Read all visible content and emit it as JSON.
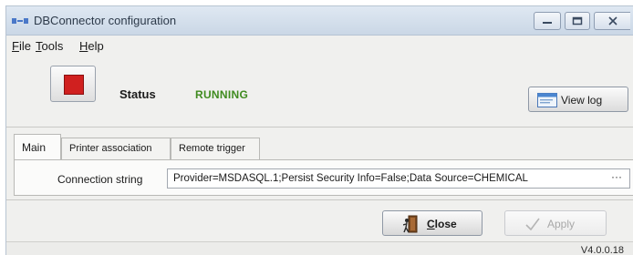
{
  "window": {
    "title": "DBConnector configuration",
    "controls": [
      "minimize-icon",
      "maximize-icon",
      "close-icon"
    ]
  },
  "menu": {
    "items": [
      {
        "mnemonic": "F",
        "rest": "ile"
      },
      {
        "mnemonic": "T",
        "rest": "ools"
      },
      {
        "mnemonic": "H",
        "rest": "elp"
      }
    ]
  },
  "status": {
    "label": "Status",
    "value": "RUNNING",
    "value_color": "#3f8b1f",
    "stop_color": "#d0201f"
  },
  "view_log": {
    "label": "View log",
    "icon": "log-window-icon"
  },
  "tabs": [
    {
      "label": "Main",
      "active": true
    },
    {
      "label": "Printer association",
      "active": false
    },
    {
      "label": "Remote trigger",
      "active": false
    }
  ],
  "connection": {
    "label": "Connection string",
    "value": "Provider=MSDASQL.1;Persist Security Info=False;Data Source=CHEMICAL",
    "browse": "···"
  },
  "buttons": {
    "close": {
      "mnemonic": "C",
      "rest": "lose",
      "icon": "door-exit-icon"
    },
    "apply": {
      "label": "Apply",
      "enabled": false,
      "icon": "checkmark-icon"
    }
  },
  "version": "V4.0.0.18"
}
